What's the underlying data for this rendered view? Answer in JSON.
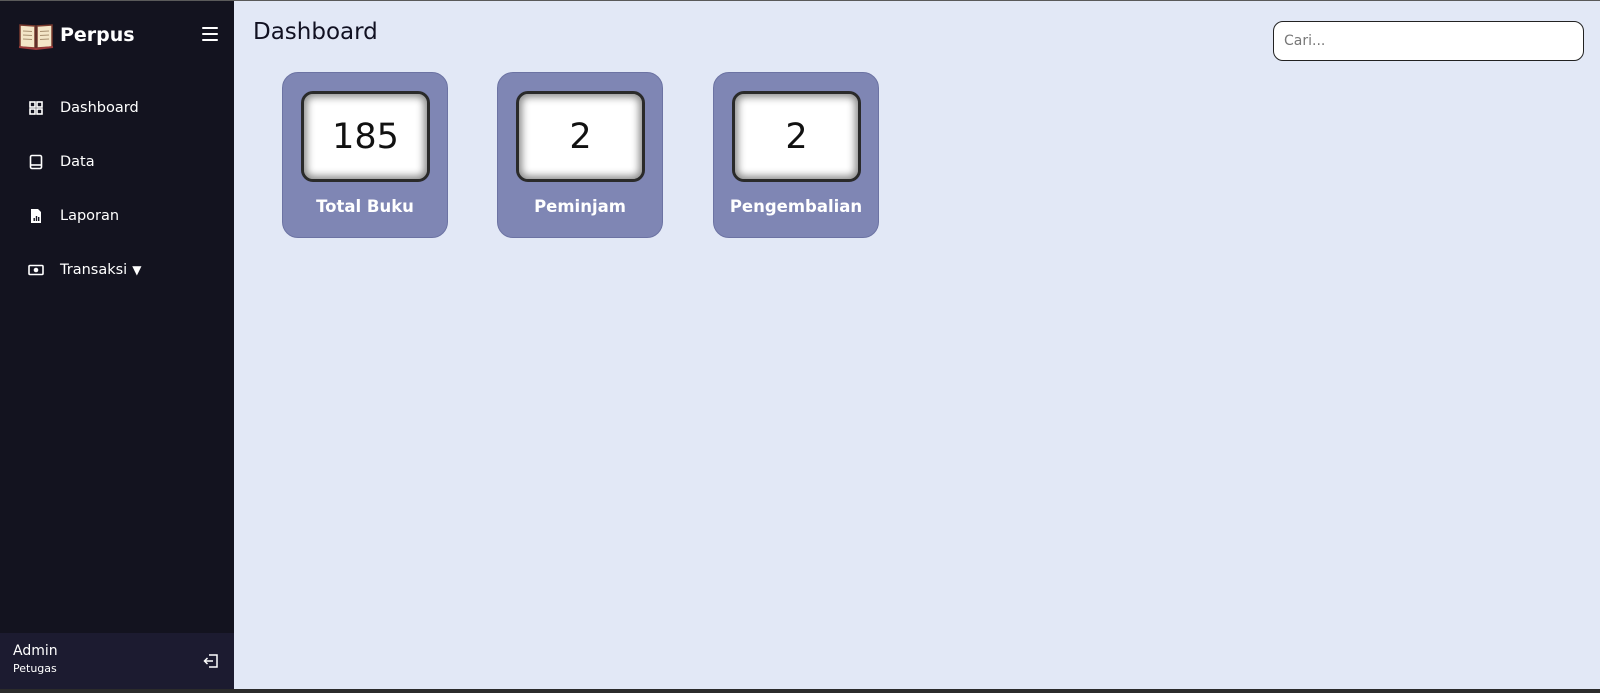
{
  "brand": {
    "name": "Perpus",
    "logo_icon": "open-book-icon"
  },
  "sidebar": {
    "items": [
      {
        "label": "Dashboard",
        "icon": "grid-icon"
      },
      {
        "label": "Data",
        "icon": "book-icon"
      },
      {
        "label": "Laporan",
        "icon": "report-file-icon"
      },
      {
        "label": "Transaksi",
        "icon": "money-icon",
        "caret": "▼"
      }
    ],
    "user": {
      "name": "Admin",
      "role": "Petugas"
    }
  },
  "main": {
    "title": "Dashboard",
    "search": {
      "placeholder": "Cari...",
      "value": ""
    },
    "cards": [
      {
        "value": "185",
        "label": "Total Buku"
      },
      {
        "value": "2",
        "label": "Peminjam"
      },
      {
        "value": "2",
        "label": "Pengembalian"
      }
    ]
  },
  "colors": {
    "sidebar_bg": "#13131f",
    "main_bg": "#e2e8f6",
    "card_bg": "#7f86b4",
    "user_panel_bg": "#1c1b30"
  }
}
